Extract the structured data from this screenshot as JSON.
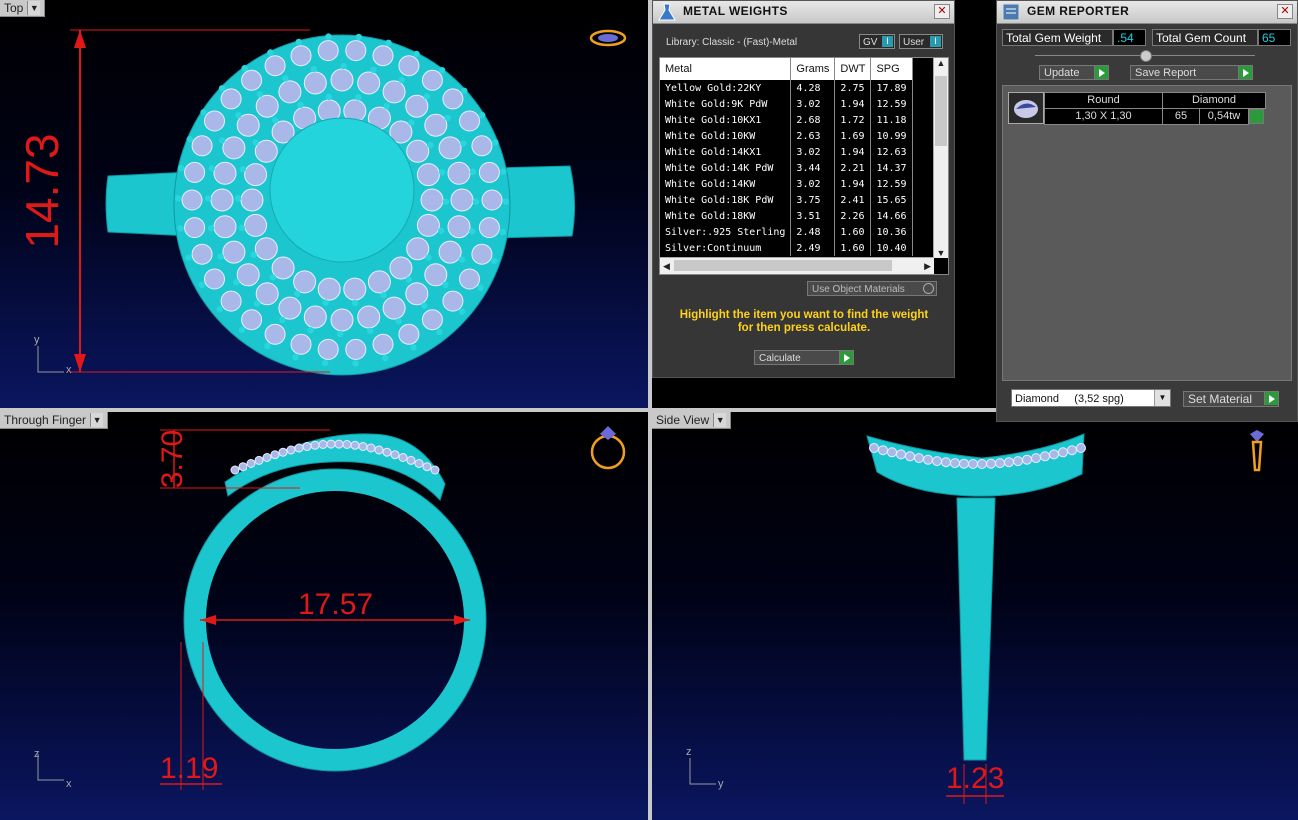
{
  "viewports": {
    "top": {
      "label": "Top",
      "dim_height": "14.73",
      "axis_y": "y",
      "axis_x": "x"
    },
    "through_finger": {
      "label": "Through Finger",
      "dim_top": "3.70",
      "dim_inner": "17.57",
      "dim_bottom": "1.19",
      "axis_y": "z",
      "axis_x": "x"
    },
    "side": {
      "label": "Side View",
      "dim_bottom": "1.23",
      "axis_y": "z",
      "axis_x": "y"
    }
  },
  "metal_weights": {
    "title": "METAL WEIGHTS",
    "library": "Library: Classic - (Fast)-Metal",
    "toggle_gv": "GV",
    "toggle_user": "User",
    "columns": [
      "Metal",
      "Grams",
      "DWT",
      "SPG"
    ],
    "rows": [
      [
        "Yellow Gold:22KY",
        "4.28",
        "2.75",
        "17.89"
      ],
      [
        "White Gold:9K PdW",
        "3.02",
        "1.94",
        "12.59"
      ],
      [
        "White Gold:10KX1",
        "2.68",
        "1.72",
        "11.18"
      ],
      [
        "White Gold:10KW",
        "2.63",
        "1.69",
        "10.99"
      ],
      [
        "White Gold:14KX1",
        "3.02",
        "1.94",
        "12.63"
      ],
      [
        "White Gold:14K PdW",
        "3.44",
        "2.21",
        "14.37"
      ],
      [
        "White Gold:14KW",
        "3.02",
        "1.94",
        "12.59"
      ],
      [
        "White Gold:18K PdW",
        "3.75",
        "2.41",
        "15.65"
      ],
      [
        "White Gold:18KW",
        "3.51",
        "2.26",
        "14.66"
      ],
      [
        "Silver:.925 Sterling",
        "2.48",
        "1.60",
        "10.36"
      ],
      [
        "Silver:Continuum",
        "2.49",
        "1.60",
        "10.40"
      ]
    ],
    "use_object_materials": "Use Object Materials",
    "message": "Highlight the item you want to find the weight for then press calculate.",
    "calculate": "Calculate"
  },
  "gem_reporter": {
    "title": "GEM REPORTER",
    "total_weight_label": "Total Gem Weight",
    "total_weight_value": ".54",
    "total_count_label": "Total Gem Count",
    "total_count_value": "65",
    "update": "Update",
    "save_report": "Save Report",
    "gem_shape": "Round",
    "gem_material": "Diamond",
    "gem_size": "1,30 X 1,30",
    "gem_count": "65",
    "gem_tw": "0,54tw",
    "material_select": "Diamond     (3,52 spg)",
    "set_material": "Set Material"
  },
  "colors": {
    "model": "#1cc6cf",
    "dimension": "#e01818",
    "accent_green": "#2b9a3a",
    "panel": "#363636"
  }
}
